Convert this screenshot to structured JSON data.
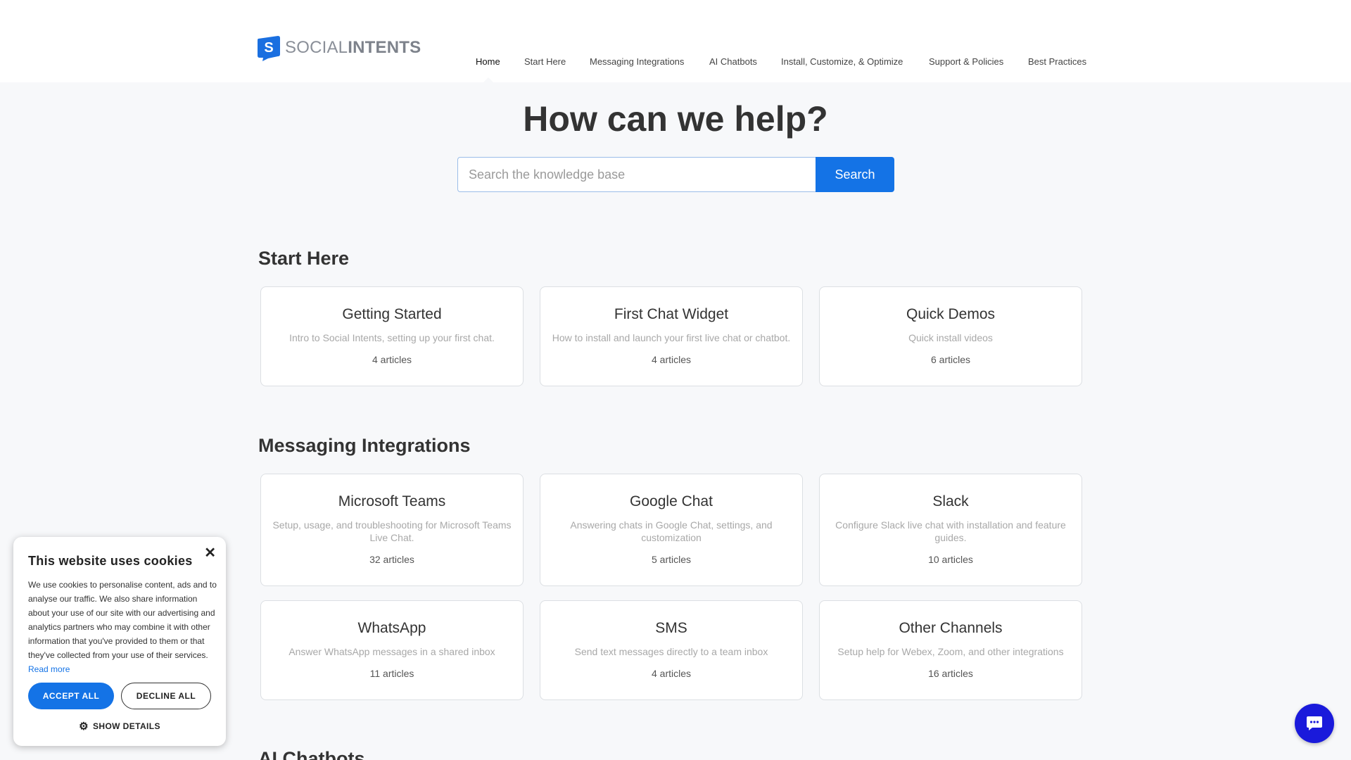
{
  "brand": {
    "name_light": "SOCIAL",
    "name_bold": "INTENTS",
    "logo_icon": "social-intents-logo-icon"
  },
  "nav": [
    {
      "label": "Home",
      "active": true
    },
    {
      "label": "Start Here"
    },
    {
      "label": "Messaging Integrations"
    },
    {
      "label": "AI Chatbots"
    },
    {
      "label": "Install, Customize, & Optimize"
    },
    {
      "label": "Support & Policies"
    },
    {
      "label": "Best Practices"
    }
  ],
  "hero": {
    "title": "How can we help?",
    "search_placeholder": "Search the knowledge base",
    "search_value": "",
    "search_button": "Search"
  },
  "sections": [
    {
      "title": "Start Here",
      "cards": [
        {
          "title": "Getting Started",
          "desc": "Intro to Social Intents, setting up your first chat.",
          "count": "4 articles"
        },
        {
          "title": "First Chat Widget",
          "desc": "How to install and launch your first live chat or chatbot.",
          "count": "4 articles"
        },
        {
          "title": "Quick Demos",
          "desc": "Quick install videos",
          "count": "6 articles"
        }
      ]
    },
    {
      "title": "Messaging Integrations",
      "cards": [
        {
          "title": "Microsoft Teams",
          "desc": "Setup, usage, and troubleshooting for Microsoft Teams Live Chat.",
          "count": "32 articles"
        },
        {
          "title": "Google Chat",
          "desc": "Answering chats in Google Chat, settings, and customization",
          "count": "5 articles"
        },
        {
          "title": "Slack",
          "desc": "Configure Slack live chat with installation and feature guides.",
          "count": "10 articles"
        },
        {
          "title": "WhatsApp",
          "desc": "Answer WhatsApp messages in a shared inbox",
          "count": "11 articles"
        },
        {
          "title": "SMS",
          "desc": "Send text messages directly to a team inbox",
          "count": "4 articles"
        },
        {
          "title": "Other Channels",
          "desc": "Setup help for Webex, Zoom, and other integrations",
          "count": "16 articles"
        }
      ]
    },
    {
      "title": "AI Chatbots",
      "cards": []
    }
  ],
  "cookie": {
    "title": "This website uses cookies",
    "text": "We use cookies to personalise content, ads and to analyse our traffic. We also share information about your use of our site with our advertising and analytics partners who may combine it with other information that you've provided to them or that they've collected from your use of their services.",
    "read_more": "Read more",
    "accept": "ACCEPT ALL",
    "decline": "DECLINE ALL",
    "details": "SHOW DETAILS",
    "close_icon": "close-icon",
    "details_icon": "gear-icon"
  },
  "chat_widget": {
    "icon": "chat-bubble-icon"
  },
  "colors": {
    "accent": "#1473e6",
    "chat": "#1a1adb",
    "background": "#f7f8fa"
  }
}
